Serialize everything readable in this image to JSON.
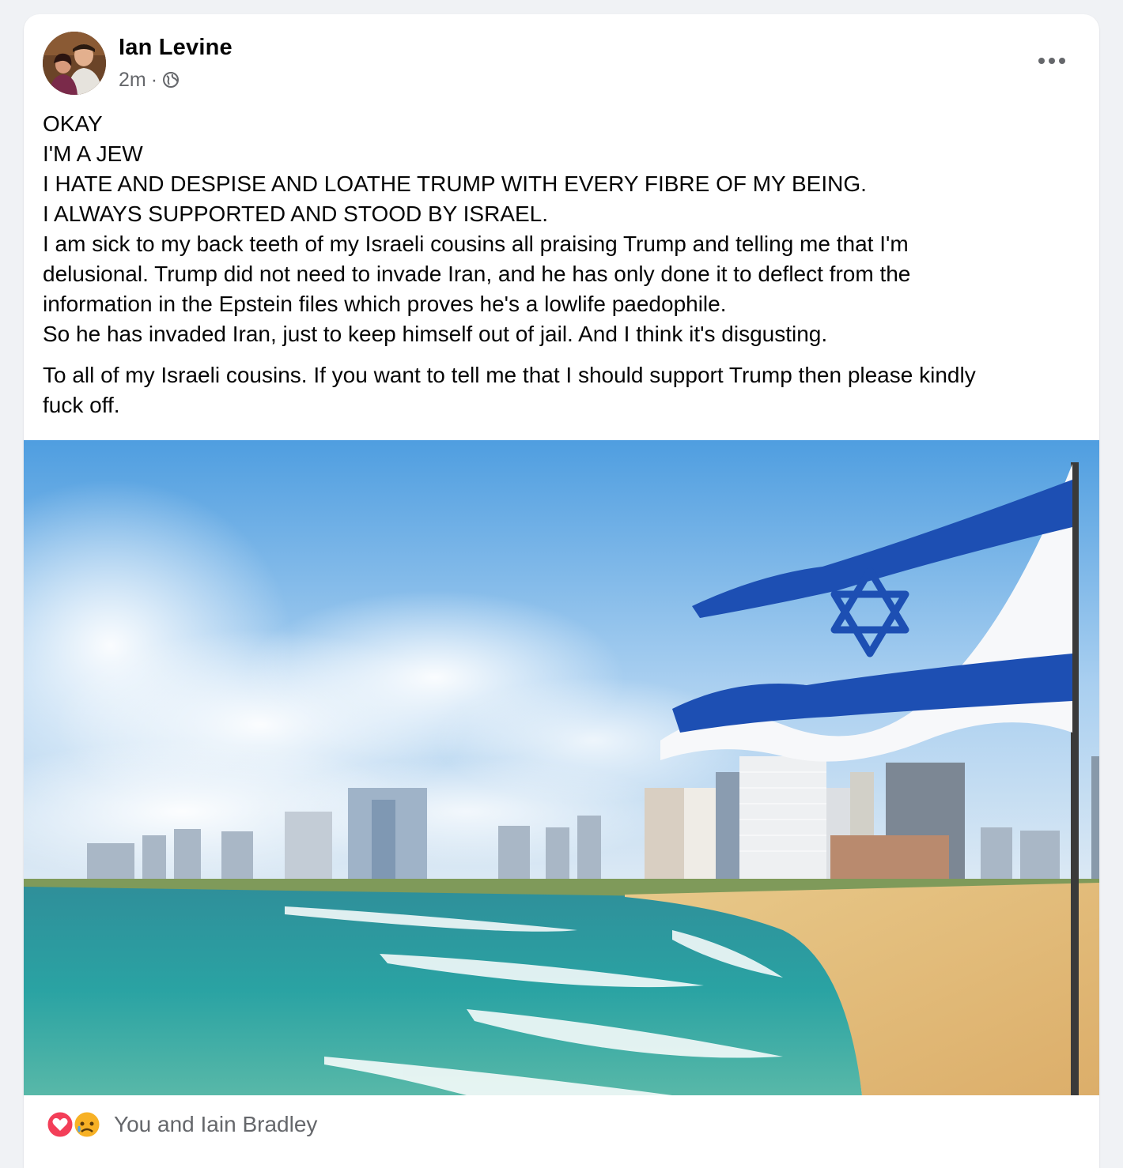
{
  "post": {
    "author_name": "Ian Levine",
    "timestamp": "2m",
    "separator": "·",
    "audience_icon": "globe-icon",
    "more_icon": "more-horizontal-icon",
    "body_lines": [
      "OKAY",
      "I'M A JEW",
      "I HATE AND DESPISE AND LOATHE TRUMP WITH EVERY FIBRE OF MY BEING.",
      "I ALWAYS SUPPORTED AND STOOD BY ISRAEL.",
      "I am sick to my back teeth of my Israeli cousins all praising Trump and telling me that I'm",
      "delusional. Trump did not need to invade Iran, and he has only done it to deflect from the",
      "information in the Epstein files which proves he's a lowlife paedophile.",
      "So he has invaded Iran, just to keep himself out of jail. And I think it's disgusting."
    ],
    "body_para2_lines": [
      "To all of my Israeli cousins. If you want to tell me that I should support Trump then please kindly",
      "fuck off."
    ]
  },
  "reactions": {
    "icons": [
      "love-reaction-icon",
      "sad-reaction-icon"
    ],
    "names": "You and Iain Bradley"
  },
  "colors": {
    "text_primary": "#050505",
    "text_secondary": "#65676b",
    "love_red": "#f33e58",
    "sad_yellow": "#f7b125",
    "flag_blue": "#1d4fb3"
  }
}
